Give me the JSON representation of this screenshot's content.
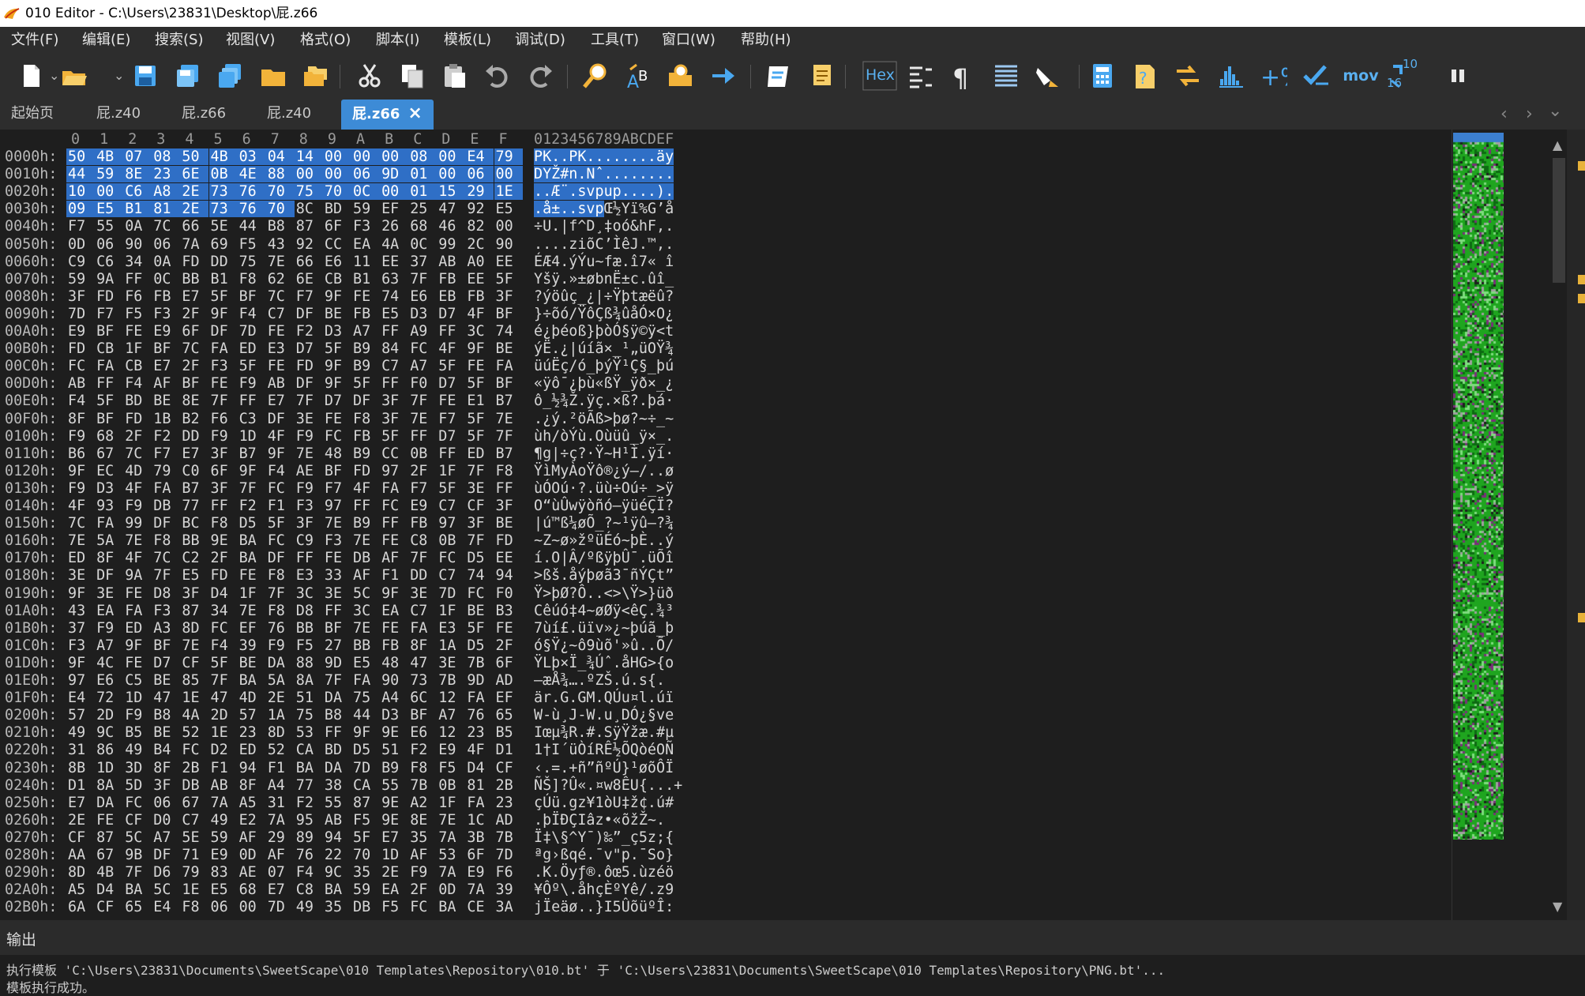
{
  "window": {
    "title": "010 Editor - C:\\Users\\23831\\Desktop\\屁.z66"
  },
  "menu": [
    "文件(F)",
    "编辑(E)",
    "搜索(S)",
    "视图(V)",
    "格式(O)",
    "脚本(I)",
    "模板(L)",
    "调试(D)",
    "工具(T)",
    "窗口(W)",
    "帮助(H)"
  ],
  "toolbar": {
    "icons": [
      "new-file-icon",
      "open-file-icon",
      "save-icon",
      "save-as-icon",
      "save-all-icon",
      "open-folder-icon",
      "open-workspace-icon",
      "cut-icon",
      "copy-icon",
      "paste-icon",
      "undo-icon",
      "redo-icon",
      "find-icon",
      "replace-icon",
      "find-in-files-icon",
      "goto-icon",
      "run-script-icon",
      "run-template-icon",
      "hex-mode-icon",
      "edit-mode-icon",
      "pilcrow-icon",
      "columns-icon",
      "highlight-icon",
      "calculator-icon",
      "inspector-icon",
      "compare-icon",
      "histogram-icon",
      "percent-icon",
      "checksum-icon",
      "mov-icon",
      "base-convert-icon",
      "pause-icon"
    ],
    "hex_label": "Hex",
    "mov_label": "mov",
    "base_label_top": "10",
    "base_label_bottom": "16"
  },
  "tabs": [
    {
      "label": "起始页",
      "active": false
    },
    {
      "label": "屁.z40",
      "active": false
    },
    {
      "label": "屁.z66",
      "active": false
    },
    {
      "label": "屁.z40",
      "active": false
    },
    {
      "label": "屁.z66",
      "active": true
    }
  ],
  "hex": {
    "column_header": [
      "0",
      "1",
      "2",
      "3",
      "4",
      "5",
      "6",
      "7",
      "8",
      "9",
      "A",
      "B",
      "C",
      "D",
      "E",
      "F"
    ],
    "ascii_header": "0123456789ABCDEF",
    "selected_count": 56,
    "rows": [
      {
        "addr": "0000h:",
        "bytes": [
          "50",
          "4B",
          "07",
          "08",
          "50",
          "4B",
          "03",
          "04",
          "14",
          "00",
          "00",
          "00",
          "08",
          "00",
          "E4",
          "79"
        ],
        "ascii": "PK..PK........äy"
      },
      {
        "addr": "0010h:",
        "bytes": [
          "44",
          "59",
          "8E",
          "23",
          "6E",
          "0B",
          "4E",
          "88",
          "00",
          "00",
          "06",
          "9D",
          "01",
          "00",
          "06",
          "00"
        ],
        "ascii": "DYŽ#n.Nˆ........"
      },
      {
        "addr": "0020h:",
        "bytes": [
          "10",
          "00",
          "C6",
          "A8",
          "2E",
          "73",
          "76",
          "70",
          "75",
          "70",
          "0C",
          "00",
          "01",
          "15",
          "29",
          "1E"
        ],
        "ascii": "..Æ¨.svpup....)."
      },
      {
        "addr": "0030h:",
        "bytes": [
          "09",
          "E5",
          "B1",
          "81",
          "2E",
          "73",
          "76",
          "70",
          "8C",
          "BD",
          "59",
          "EF",
          "25",
          "47",
          "92",
          "E5"
        ],
        "ascii": ".å±..svpŒ½Yï%G’å"
      },
      {
        "addr": "0040h:",
        "bytes": [
          "F7",
          "55",
          "0A",
          "7C",
          "66",
          "5E",
          "44",
          "B8",
          "87",
          "6F",
          "F3",
          "26",
          "68",
          "46",
          "82",
          "00"
        ],
        "ascii": "÷U.|f^D¸‡oó&hF‚."
      },
      {
        "addr": "0050h:",
        "bytes": [
          "0D",
          "06",
          "90",
          "06",
          "7A",
          "69",
          "F5",
          "43",
          "92",
          "CC",
          "EA",
          "4A",
          "0C",
          "99",
          "2C",
          "90"
        ],
        "ascii": "....ziõC’ÌêJ.™,."
      },
      {
        "addr": "0060h:",
        "bytes": [
          "C9",
          "C6",
          "34",
          "0A",
          "FD",
          "DD",
          "75",
          "7E",
          "66",
          "E6",
          "11",
          "EE",
          "37",
          "AB",
          "A0",
          "EE"
        ],
        "ascii": "ÉÆ4.ýÝu~fæ.î7« î"
      },
      {
        "addr": "0070h:",
        "bytes": [
          "59",
          "9A",
          "FF",
          "0C",
          "BB",
          "B1",
          "F8",
          "62",
          "6E",
          "CB",
          "B1",
          "63",
          "7F",
          "FB",
          "EE",
          "5F"
        ],
        "ascii": "Yšÿ.»±øbnË±c.ûî_"
      },
      {
        "addr": "0080h:",
        "bytes": [
          "3F",
          "FD",
          "F6",
          "FB",
          "E7",
          "5F",
          "BF",
          "7C",
          "F7",
          "9F",
          "FE",
          "74",
          "E6",
          "EB",
          "FB",
          "3F"
        ],
        "ascii": "?ýöûç_¿|÷Ÿþtæëû?"
      },
      {
        "addr": "0090h:",
        "bytes": [
          "7D",
          "F7",
          "F5",
          "F3",
          "2F",
          "9F",
          "F4",
          "C7",
          "DF",
          "BE",
          "FB",
          "E5",
          "D3",
          "D7",
          "4F",
          "BF"
        ],
        "ascii": "}÷õó/ŸôÇß¾ûåÓ×O¿"
      },
      {
        "addr": "00A0h:",
        "bytes": [
          "E9",
          "BF",
          "FE",
          "E9",
          "6F",
          "DF",
          "7D",
          "FE",
          "F2",
          "D3",
          "A7",
          "FF",
          "A9",
          "FF",
          "3C",
          "74"
        ],
        "ascii": "é¿þéoß}þòÓ§ÿ©ÿ<t"
      },
      {
        "addr": "00B0h:",
        "bytes": [
          "FD",
          "CB",
          "1F",
          "BF",
          "7C",
          "FA",
          "ED",
          "E3",
          "D7",
          "5F",
          "B9",
          "84",
          "FC",
          "4F",
          "9F",
          "BE"
        ],
        "ascii": "ýË.¿|úíã×_¹„üOŸ¾"
      },
      {
        "addr": "00C0h:",
        "bytes": [
          "FC",
          "FA",
          "CB",
          "E7",
          "2F",
          "F3",
          "5F",
          "FE",
          "FD",
          "9F",
          "B9",
          "C7",
          "A7",
          "5F",
          "FE",
          "FA"
        ],
        "ascii": "üúËç/ó_þýŸ¹Ç§_þú"
      },
      {
        "addr": "00D0h:",
        "bytes": [
          "AB",
          "FF",
          "F4",
          "AF",
          "BF",
          "FE",
          "F9",
          "AB",
          "DF",
          "9F",
          "5F",
          "FF",
          "F0",
          "D7",
          "5F",
          "BF"
        ],
        "ascii": "«ÿô¯¿þù«ßŸ_ÿð×_¿"
      },
      {
        "addr": "00E0h:",
        "bytes": [
          "F4",
          "5F",
          "BD",
          "BE",
          "8E",
          "7F",
          "FF",
          "E7",
          "7F",
          "D7",
          "DF",
          "3F",
          "7F",
          "FE",
          "E1",
          "B7"
        ],
        "ascii": "ô_½¾Ž.ÿç.×ß?.þá·"
      },
      {
        "addr": "00F0h:",
        "bytes": [
          "8F",
          "BF",
          "FD",
          "1B",
          "B2",
          "F6",
          "C3",
          "DF",
          "3E",
          "FE",
          "F8",
          "3F",
          "7E",
          "F7",
          "5F",
          "7E"
        ],
        "ascii": ".¿ý.²öÃß>þø?~÷_~"
      },
      {
        "addr": "0100h:",
        "bytes": [
          "F9",
          "68",
          "2F",
          "F2",
          "DD",
          "F9",
          "1D",
          "4F",
          "F9",
          "FC",
          "FB",
          "5F",
          "FF",
          "D7",
          "5F",
          "7F"
        ],
        "ascii": "ùh/òÝù.Oùüû_ÿ×_."
      },
      {
        "addr": "0110h:",
        "bytes": [
          "B6",
          "67",
          "7C",
          "F7",
          "E7",
          "3F",
          "B7",
          "9F",
          "7E",
          "48",
          "B9",
          "CC",
          "0B",
          "FF",
          "ED",
          "B7"
        ],
        "ascii": "¶g|÷ç?·Ÿ~H¹Ì.ÿí·"
      },
      {
        "addr": "0120h:",
        "bytes": [
          "9F",
          "EC",
          "4D",
          "79",
          "C0",
          "6F",
          "9F",
          "F4",
          "AE",
          "BF",
          "FD",
          "97",
          "2F",
          "1F",
          "7F",
          "F8"
        ],
        "ascii": "ŸìMyÀoŸô®¿ý—/..ø"
      },
      {
        "addr": "0130h:",
        "bytes": [
          "F9",
          "D3",
          "4F",
          "FA",
          "B7",
          "3F",
          "7F",
          "FC",
          "F9",
          "F7",
          "4F",
          "FA",
          "F7",
          "5F",
          "3E",
          "FF"
        ],
        "ascii": "ùÓOú·?.üù÷Oú÷_>ÿ"
      },
      {
        "addr": "0140h:",
        "bytes": [
          "4F",
          "93",
          "F9",
          "DB",
          "77",
          "FF",
          "F2",
          "F1",
          "F3",
          "97",
          "FF",
          "FC",
          "E9",
          "C7",
          "CF",
          "3F"
        ],
        "ascii": "O“ùÛwÿòñó—ÿüéÇÏ?"
      },
      {
        "addr": "0150h:",
        "bytes": [
          "7C",
          "FA",
          "99",
          "DF",
          "BC",
          "F8",
          "D5",
          "5F",
          "3F",
          "7E",
          "B9",
          "FF",
          "FB",
          "97",
          "3F",
          "BE"
        ],
        "ascii": "|ú™ß¼øÕ_?~¹ÿû—?¾"
      },
      {
        "addr": "0160h:",
        "bytes": [
          "7E",
          "5A",
          "7E",
          "F8",
          "BB",
          "9E",
          "BA",
          "FC",
          "C9",
          "F3",
          "7E",
          "FE",
          "C8",
          "0B",
          "7F",
          "FD"
        ],
        "ascii": "~Z~ø»žºüÉó~þÈ..ý"
      },
      {
        "addr": "0170h:",
        "bytes": [
          "ED",
          "8F",
          "4F",
          "7C",
          "C2",
          "2F",
          "BA",
          "DF",
          "FF",
          "FE",
          "DB",
          "AF",
          "7F",
          "FC",
          "D5",
          "EE"
        ],
        "ascii": "í.O|Â/ºßÿþÛ¯.üÕî"
      },
      {
        "addr": "0180h:",
        "bytes": [
          "3E",
          "DF",
          "9A",
          "7F",
          "E5",
          "FD",
          "FE",
          "F8",
          "E3",
          "33",
          "AF",
          "F1",
          "DD",
          "C7",
          "74",
          "94"
        ],
        "ascii": ">ßš.åýþøã3¯ñÝÇt”"
      },
      {
        "addr": "0190h:",
        "bytes": [
          "9F",
          "3E",
          "FE",
          "D8",
          "3F",
          "D4",
          "1F",
          "7F",
          "3C",
          "3E",
          "5C",
          "9F",
          "3E",
          "7D",
          "FC",
          "F0"
        ],
        "ascii": "Ÿ>þØ?Ô..<>\\Ÿ>}üð"
      },
      {
        "addr": "01A0h:",
        "bytes": [
          "43",
          "EA",
          "FA",
          "F3",
          "87",
          "34",
          "7E",
          "F8",
          "D8",
          "FF",
          "3C",
          "EA",
          "C7",
          "1F",
          "BE",
          "B3"
        ],
        "ascii": "Cêúó‡4~øØÿ<êÇ.¾³"
      },
      {
        "addr": "01B0h:",
        "bytes": [
          "37",
          "F9",
          "ED",
          "A3",
          "8D",
          "FC",
          "EF",
          "76",
          "BB",
          "BF",
          "7E",
          "FE",
          "FA",
          "E3",
          "5F",
          "FE"
        ],
        "ascii": "7ùí£.üïv»¿~þúã_þ"
      },
      {
        "addr": "01C0h:",
        "bytes": [
          "F3",
          "A7",
          "9F",
          "BF",
          "7E",
          "F4",
          "39",
          "F9",
          "F5",
          "27",
          "BB",
          "FB",
          "8F",
          "1A",
          "D5",
          "2F"
        ],
        "ascii": "ó§Ÿ¿~ô9ùõ'»û..Õ/"
      },
      {
        "addr": "01D0h:",
        "bytes": [
          "9F",
          "4C",
          "FE",
          "D7",
          "CF",
          "5F",
          "BE",
          "DA",
          "88",
          "9D",
          "E5",
          "48",
          "47",
          "3E",
          "7B",
          "6F"
        ],
        "ascii": "ŸLþ×Ï_¾Úˆ.åHG>{o"
      },
      {
        "addr": "01E0h:",
        "bytes": [
          "97",
          "E6",
          "C5",
          "BE",
          "85",
          "7F",
          "BA",
          "5A",
          "8A",
          "7F",
          "FA",
          "90",
          "73",
          "7B",
          "9D",
          "AD"
        ],
        "ascii": "—æÅ¾….ºZŠ.ú.s{.­"
      },
      {
        "addr": "01F0h:",
        "bytes": [
          "E4",
          "72",
          "1D",
          "47",
          "1E",
          "47",
          "4D",
          "2E",
          "51",
          "DA",
          "75",
          "A4",
          "6C",
          "12",
          "FA",
          "EF"
        ],
        "ascii": "är.G.GM.QÚu¤l.úï"
      },
      {
        "addr": "0200h:",
        "bytes": [
          "57",
          "2D",
          "F9",
          "B8",
          "4A",
          "2D",
          "57",
          "1A",
          "75",
          "B8",
          "44",
          "D3",
          "BF",
          "A7",
          "76",
          "65"
        ],
        "ascii": "W-ù¸J-W.u¸DÓ¿§ve"
      },
      {
        "addr": "0210h:",
        "bytes": [
          "49",
          "9C",
          "B5",
          "BE",
          "52",
          "1E",
          "23",
          "8D",
          "53",
          "FF",
          "9F",
          "9E",
          "E6",
          "12",
          "23",
          "B5"
        ],
        "ascii": "Iœµ¾R.#.SÿŸžæ.#µ"
      },
      {
        "addr": "0220h:",
        "bytes": [
          "31",
          "86",
          "49",
          "B4",
          "FC",
          "D2",
          "ED",
          "52",
          "CA",
          "BD",
          "D5",
          "51",
          "F2",
          "E9",
          "4F",
          "D1"
        ],
        "ascii": "1†I´üÒíRÊ½ÕQòéOÑ"
      },
      {
        "addr": "0230h:",
        "bytes": [
          "8B",
          "1D",
          "3D",
          "8F",
          "2B",
          "F1",
          "94",
          "F1",
          "BA",
          "DA",
          "7D",
          "B9",
          "F8",
          "F5",
          "D4",
          "CF"
        ],
        "ascii": "‹.=.+ñ”ñºÚ}¹øõÔÏ"
      },
      {
        "addr": "0240h:",
        "bytes": [
          "D1",
          "8A",
          "5D",
          "3F",
          "DB",
          "AB",
          "8F",
          "A4",
          "77",
          "38",
          "CA",
          "55",
          "7B",
          "0B",
          "81",
          "2B"
        ],
        "ascii": "ÑŠ]?Û«.¤w8ÊU{...+"
      },
      {
        "addr": "0250h:",
        "bytes": [
          "E7",
          "DA",
          "FC",
          "06",
          "67",
          "7A",
          "A5",
          "31",
          "F2",
          "55",
          "87",
          "9E",
          "A2",
          "1F",
          "FA",
          "23"
        ],
        "ascii": "çÚü.gz¥1òU‡ž¢.ú#"
      },
      {
        "addr": "0260h:",
        "bytes": [
          "2E",
          "FE",
          "CF",
          "D0",
          "C7",
          "49",
          "E2",
          "7A",
          "95",
          "AB",
          "F5",
          "9E",
          "8E",
          "7E",
          "1C",
          "AD"
        ],
        "ascii": ".þÏÐÇIâz•«õžŽ~.­"
      },
      {
        "addr": "0270h:",
        "bytes": [
          "CF",
          "87",
          "5C",
          "A7",
          "5E",
          "59",
          "AF",
          "29",
          "89",
          "94",
          "5F",
          "E7",
          "35",
          "7A",
          "3B",
          "7B"
        ],
        "ascii": "Ï‡\\§^Y¯)‰”_ç5z;{"
      },
      {
        "addr": "0280h:",
        "bytes": [
          "AA",
          "67",
          "9B",
          "DF",
          "71",
          "E9",
          "0D",
          "AF",
          "76",
          "22",
          "70",
          "1D",
          "AF",
          "53",
          "6F",
          "7D"
        ],
        "ascii": "ªg›ßqé.¯v\"p.¯So}"
      },
      {
        "addr": "0290h:",
        "bytes": [
          "8D",
          "4B",
          "7F",
          "D6",
          "79",
          "83",
          "AE",
          "07",
          "F4",
          "9C",
          "35",
          "2E",
          "F9",
          "7A",
          "E9",
          "F6"
        ],
        "ascii": ".K.Öyƒ®.ôœ5.ùzéö"
      },
      {
        "addr": "02A0h:",
        "bytes": [
          "A5",
          "D4",
          "BA",
          "5C",
          "1E",
          "E5",
          "68",
          "E7",
          "C8",
          "BA",
          "59",
          "EA",
          "2F",
          "0D",
          "7A",
          "39"
        ],
        "ascii": "¥Ôº\\.åhçÈºYê/.z9"
      },
      {
        "addr": "02B0h:",
        "bytes": [
          "6A",
          "CF",
          "65",
          "E4",
          "F8",
          "06",
          "00",
          "7D",
          "49",
          "35",
          "DB",
          "F5",
          "FC",
          "BA",
          "CE",
          "3A"
        ],
        "ascii": "jÏeäø..}I5ÛõüºÎ:"
      }
    ]
  },
  "output": {
    "title": "输出",
    "line1": "执行模板 'C:\\Users\\23831\\Documents\\SweetScape\\010 Templates\\Repository\\010.bt' 于 'C:\\Users\\23831\\Documents\\SweetScape\\010 Templates\\Repository\\PNG.bt'...",
    "line2": "模板执行成功。"
  },
  "colors": {
    "selection": "#2f6fc6",
    "tab_active": "#3d8bd6",
    "overview_green": "#1fa51f"
  }
}
